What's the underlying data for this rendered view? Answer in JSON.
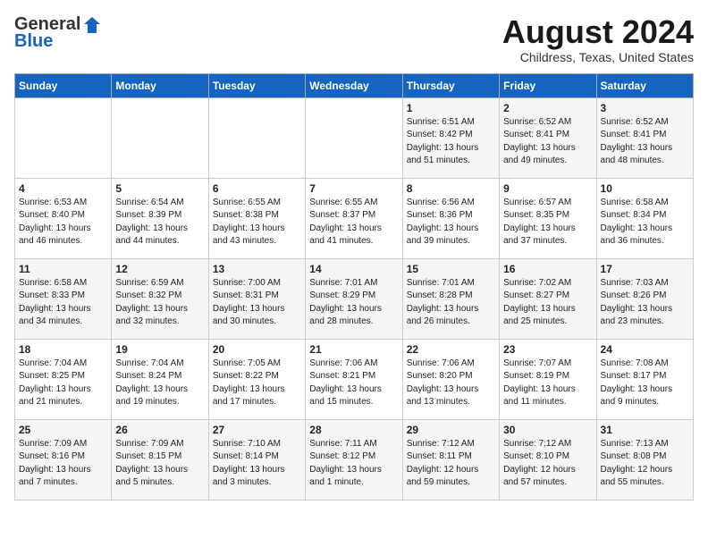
{
  "header": {
    "logo_general": "General",
    "logo_blue": "Blue",
    "month_title": "August 2024",
    "location": "Childress, Texas, United States"
  },
  "weekdays": [
    "Sunday",
    "Monday",
    "Tuesday",
    "Wednesday",
    "Thursday",
    "Friday",
    "Saturday"
  ],
  "weeks": [
    [
      {
        "day": "",
        "info": ""
      },
      {
        "day": "",
        "info": ""
      },
      {
        "day": "",
        "info": ""
      },
      {
        "day": "",
        "info": ""
      },
      {
        "day": "1",
        "info": "Sunrise: 6:51 AM\nSunset: 8:42 PM\nDaylight: 13 hours\nand 51 minutes."
      },
      {
        "day": "2",
        "info": "Sunrise: 6:52 AM\nSunset: 8:41 PM\nDaylight: 13 hours\nand 49 minutes."
      },
      {
        "day": "3",
        "info": "Sunrise: 6:52 AM\nSunset: 8:41 PM\nDaylight: 13 hours\nand 48 minutes."
      }
    ],
    [
      {
        "day": "4",
        "info": "Sunrise: 6:53 AM\nSunset: 8:40 PM\nDaylight: 13 hours\nand 46 minutes."
      },
      {
        "day": "5",
        "info": "Sunrise: 6:54 AM\nSunset: 8:39 PM\nDaylight: 13 hours\nand 44 minutes."
      },
      {
        "day": "6",
        "info": "Sunrise: 6:55 AM\nSunset: 8:38 PM\nDaylight: 13 hours\nand 43 minutes."
      },
      {
        "day": "7",
        "info": "Sunrise: 6:55 AM\nSunset: 8:37 PM\nDaylight: 13 hours\nand 41 minutes."
      },
      {
        "day": "8",
        "info": "Sunrise: 6:56 AM\nSunset: 8:36 PM\nDaylight: 13 hours\nand 39 minutes."
      },
      {
        "day": "9",
        "info": "Sunrise: 6:57 AM\nSunset: 8:35 PM\nDaylight: 13 hours\nand 37 minutes."
      },
      {
        "day": "10",
        "info": "Sunrise: 6:58 AM\nSunset: 8:34 PM\nDaylight: 13 hours\nand 36 minutes."
      }
    ],
    [
      {
        "day": "11",
        "info": "Sunrise: 6:58 AM\nSunset: 8:33 PM\nDaylight: 13 hours\nand 34 minutes."
      },
      {
        "day": "12",
        "info": "Sunrise: 6:59 AM\nSunset: 8:32 PM\nDaylight: 13 hours\nand 32 minutes."
      },
      {
        "day": "13",
        "info": "Sunrise: 7:00 AM\nSunset: 8:31 PM\nDaylight: 13 hours\nand 30 minutes."
      },
      {
        "day": "14",
        "info": "Sunrise: 7:01 AM\nSunset: 8:29 PM\nDaylight: 13 hours\nand 28 minutes."
      },
      {
        "day": "15",
        "info": "Sunrise: 7:01 AM\nSunset: 8:28 PM\nDaylight: 13 hours\nand 26 minutes."
      },
      {
        "day": "16",
        "info": "Sunrise: 7:02 AM\nSunset: 8:27 PM\nDaylight: 13 hours\nand 25 minutes."
      },
      {
        "day": "17",
        "info": "Sunrise: 7:03 AM\nSunset: 8:26 PM\nDaylight: 13 hours\nand 23 minutes."
      }
    ],
    [
      {
        "day": "18",
        "info": "Sunrise: 7:04 AM\nSunset: 8:25 PM\nDaylight: 13 hours\nand 21 minutes."
      },
      {
        "day": "19",
        "info": "Sunrise: 7:04 AM\nSunset: 8:24 PM\nDaylight: 13 hours\nand 19 minutes."
      },
      {
        "day": "20",
        "info": "Sunrise: 7:05 AM\nSunset: 8:22 PM\nDaylight: 13 hours\nand 17 minutes."
      },
      {
        "day": "21",
        "info": "Sunrise: 7:06 AM\nSunset: 8:21 PM\nDaylight: 13 hours\nand 15 minutes."
      },
      {
        "day": "22",
        "info": "Sunrise: 7:06 AM\nSunset: 8:20 PM\nDaylight: 13 hours\nand 13 minutes."
      },
      {
        "day": "23",
        "info": "Sunrise: 7:07 AM\nSunset: 8:19 PM\nDaylight: 13 hours\nand 11 minutes."
      },
      {
        "day": "24",
        "info": "Sunrise: 7:08 AM\nSunset: 8:17 PM\nDaylight: 13 hours\nand 9 minutes."
      }
    ],
    [
      {
        "day": "25",
        "info": "Sunrise: 7:09 AM\nSunset: 8:16 PM\nDaylight: 13 hours\nand 7 minutes."
      },
      {
        "day": "26",
        "info": "Sunrise: 7:09 AM\nSunset: 8:15 PM\nDaylight: 13 hours\nand 5 minutes."
      },
      {
        "day": "27",
        "info": "Sunrise: 7:10 AM\nSunset: 8:14 PM\nDaylight: 13 hours\nand 3 minutes."
      },
      {
        "day": "28",
        "info": "Sunrise: 7:11 AM\nSunset: 8:12 PM\nDaylight: 13 hours\nand 1 minute."
      },
      {
        "day": "29",
        "info": "Sunrise: 7:12 AM\nSunset: 8:11 PM\nDaylight: 12 hours\nand 59 minutes."
      },
      {
        "day": "30",
        "info": "Sunrise: 7:12 AM\nSunset: 8:10 PM\nDaylight: 12 hours\nand 57 minutes."
      },
      {
        "day": "31",
        "info": "Sunrise: 7:13 AM\nSunset: 8:08 PM\nDaylight: 12 hours\nand 55 minutes."
      }
    ]
  ]
}
